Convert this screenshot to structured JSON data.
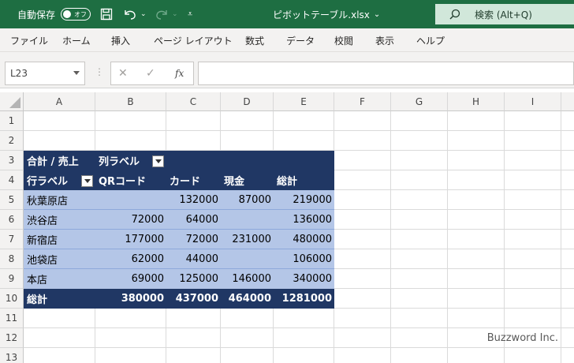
{
  "titlebar": {
    "autosave_label": "自動保存",
    "autosave_state": "オフ",
    "filename": "ピボットテーブル.xlsx",
    "search_label": "検索 (Alt+Q)"
  },
  "ribbon_tabs": [
    "ファイル",
    "ホーム",
    "挿入",
    "ページ レイアウト",
    "数式",
    "データ",
    "校閲",
    "表示",
    "ヘルプ"
  ],
  "formula_bar": {
    "name_box": "L23",
    "fx_label": "fx",
    "formula": ""
  },
  "columns": [
    "A",
    "B",
    "C",
    "D",
    "E",
    "F",
    "G",
    "H",
    "I"
  ],
  "rows": [
    "1",
    "2",
    "3",
    "4",
    "5",
    "6",
    "7",
    "8",
    "9",
    "10",
    "11",
    "12",
    "13"
  ],
  "pivot": {
    "values_label": "合計 / 売上",
    "column_labels": "列ラベル",
    "row_labels": "行ラベル",
    "headers": [
      "QRコード",
      "カード",
      "現金",
      "総計"
    ],
    "rows": [
      {
        "label": "秋葉原店",
        "values": [
          "",
          "132000",
          "87000",
          "219000"
        ]
      },
      {
        "label": "渋谷店",
        "values": [
          "72000",
          "64000",
          "",
          "136000"
        ]
      },
      {
        "label": "新宿店",
        "values": [
          "177000",
          "72000",
          "231000",
          "480000"
        ]
      },
      {
        "label": "池袋店",
        "values": [
          "62000",
          "44000",
          "",
          "106000"
        ]
      },
      {
        "label": "本店",
        "values": [
          "69000",
          "125000",
          "146000",
          "340000"
        ]
      }
    ],
    "total_label": "総計",
    "totals": [
      "380000",
      "437000",
      "464000",
      "1281000"
    ]
  },
  "watermark": "Buzzword Inc.",
  "colors": {
    "title_bar": "#1e6e42",
    "pivot_header": "#203764",
    "pivot_body": "#b4c6e7"
  }
}
